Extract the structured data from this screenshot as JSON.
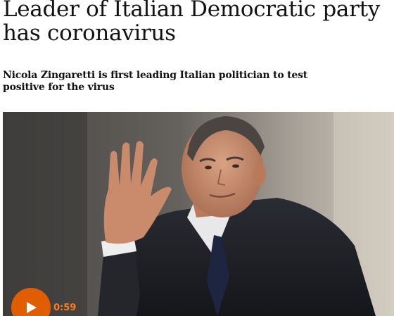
{
  "article": {
    "headline": "Leader of Italian Democratic party has coronavirus",
    "standfirst": "Nicola Zingaretti is first leading Italian politician to test positive for the virus"
  },
  "video": {
    "duration": "0:59",
    "play_icon": "play-icon",
    "accent_color": "#e05e00"
  }
}
